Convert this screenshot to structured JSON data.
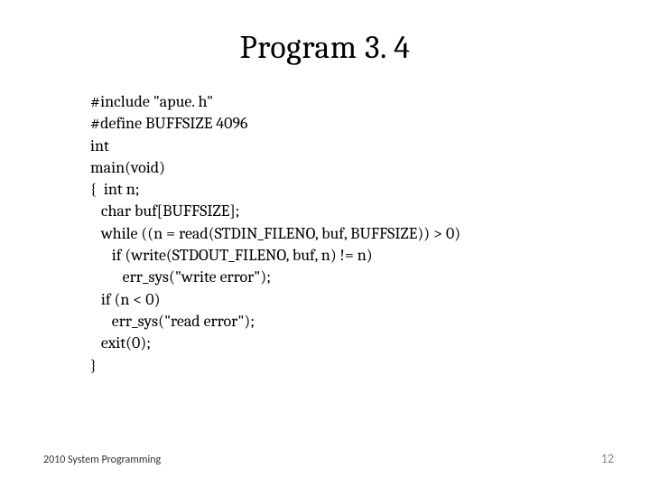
{
  "title": "Program 3. 4",
  "code_lines": [
    "#include \"apue. h\"",
    "#define BUFFSIZE 4096",
    "int",
    "main(void)",
    "{  int n;",
    "   char buf[BUFFSIZE];",
    "   while ((n = read(STDIN_FILENO, buf, BUFFSIZE)) > 0)",
    "      if (write(STDOUT_FILENO, buf, n) != n)",
    "         err_sys(\"write error\");",
    "   if (n < 0)",
    "      err_sys(\"read error\");",
    "   exit(0);",
    "}"
  ],
  "footer": {
    "left": "2010 System Programming",
    "right": "12"
  }
}
